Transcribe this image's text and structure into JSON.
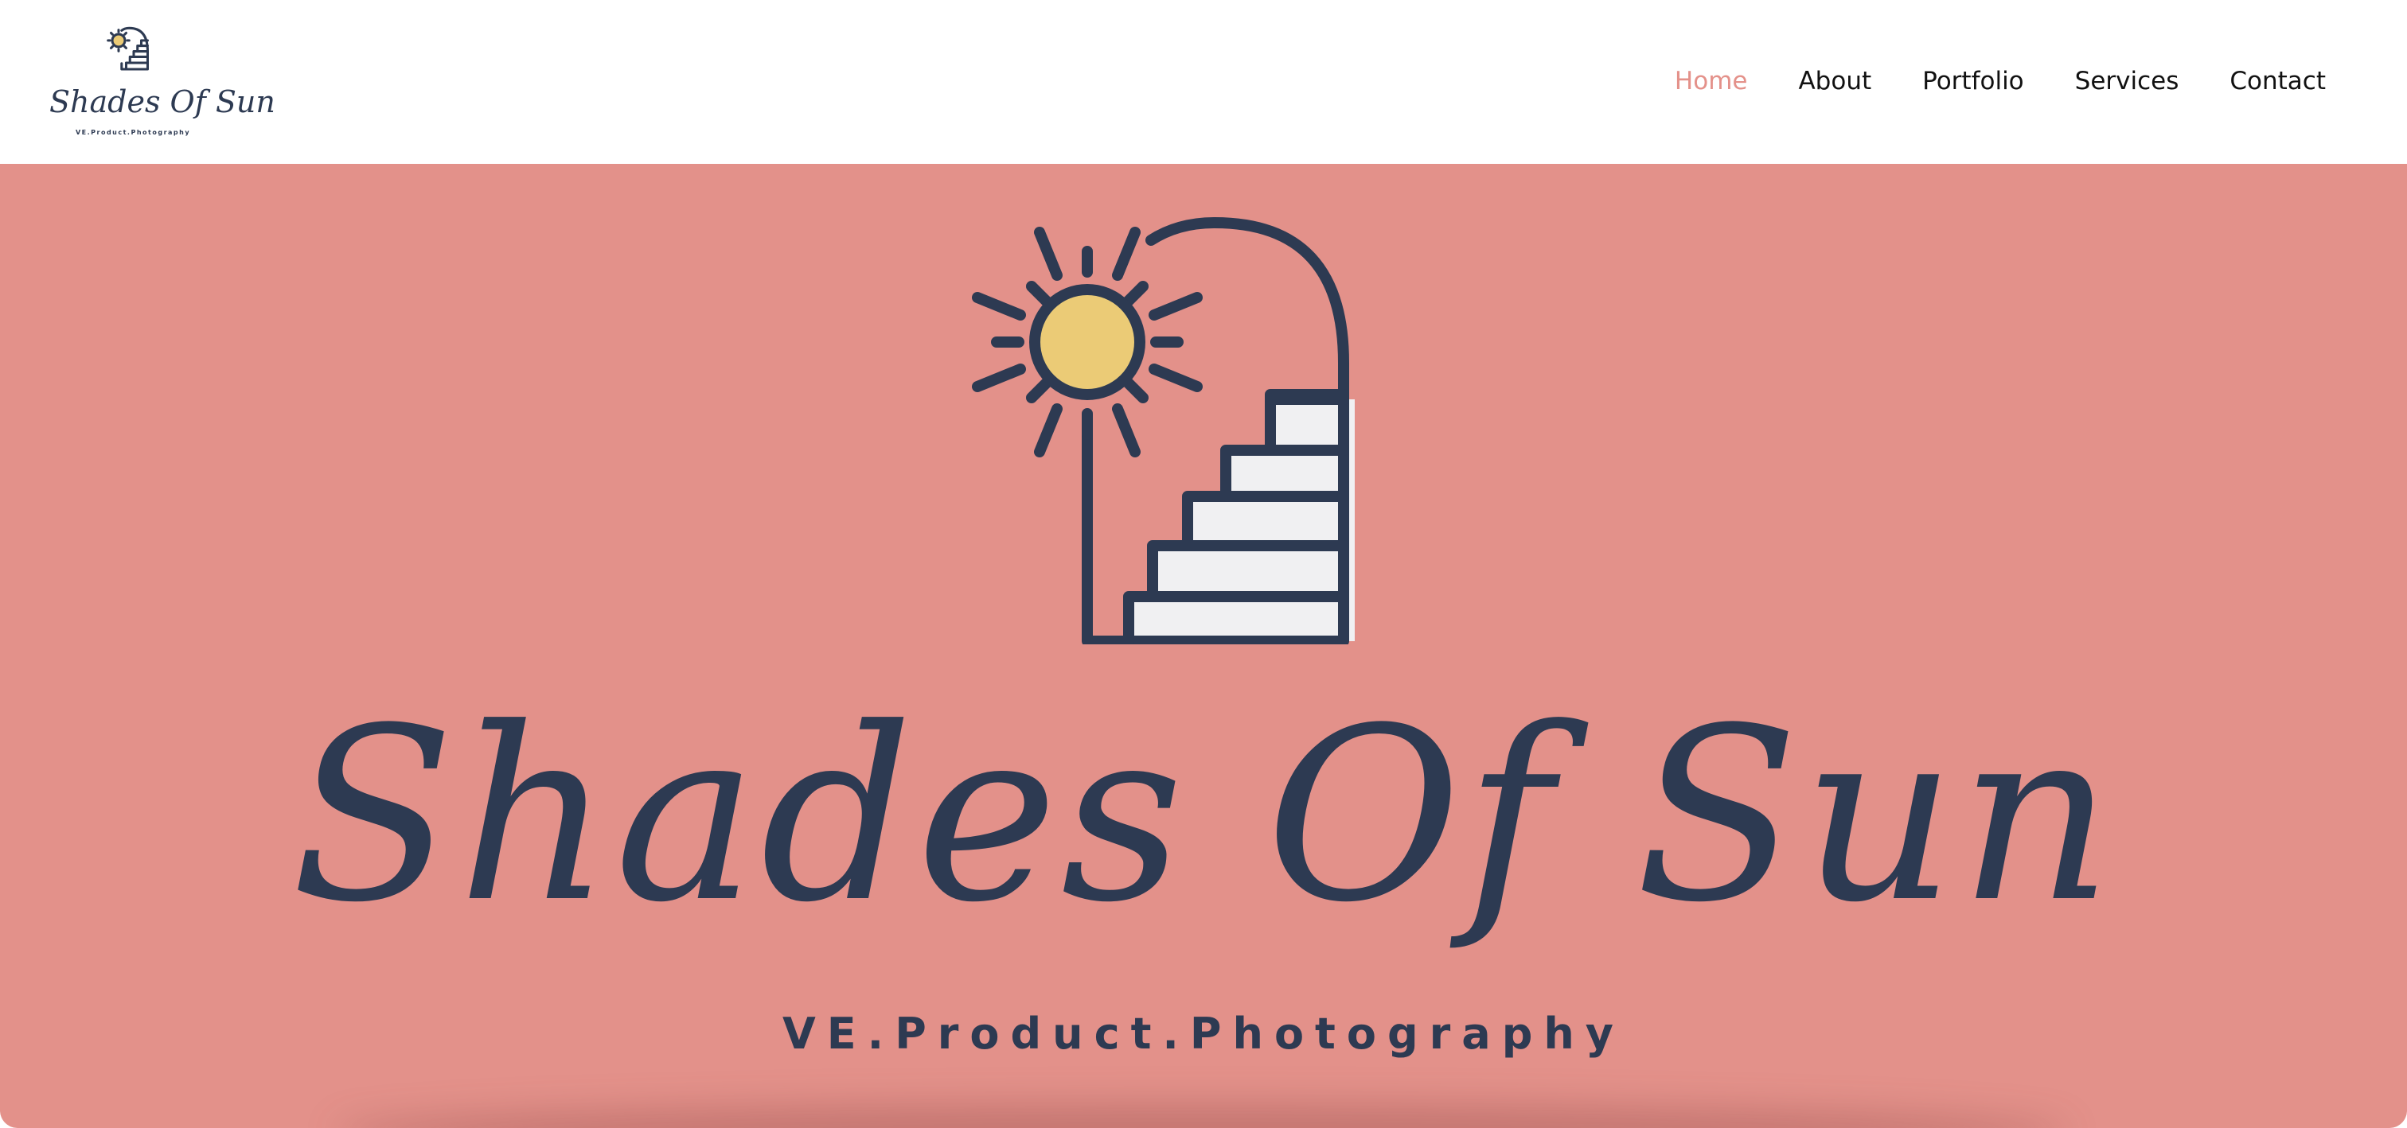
{
  "brand": {
    "name": "Shades Of Sun",
    "tagline": "VE.Product.Photography"
  },
  "nav": {
    "items": [
      {
        "label": "Home",
        "active": true
      },
      {
        "label": "About",
        "active": false
      },
      {
        "label": "Portfolio",
        "active": false
      },
      {
        "label": "Services",
        "active": false
      },
      {
        "label": "Contact",
        "active": false
      }
    ]
  },
  "hero": {
    "title": "Shades Of Sun",
    "subtitle": "VE.Product.Photography"
  },
  "colors": {
    "accent": "#e4918a",
    "hero_background": "#e3918a",
    "navy": "#2d3a52",
    "sun": "#ebcb76",
    "stairs": "#f0f0f2"
  },
  "icons": {
    "logo": "sun-stairs-arch-icon",
    "hero": "sun-stairs-arch-icon"
  }
}
